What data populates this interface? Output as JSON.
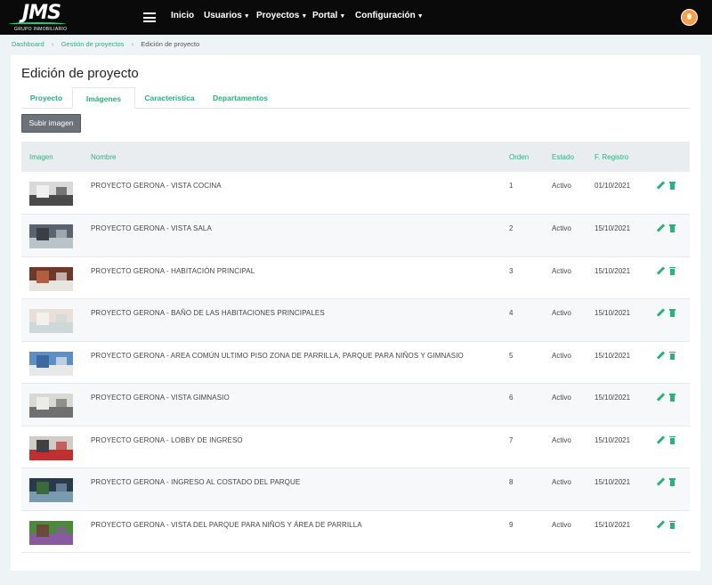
{
  "logo": {
    "text": "JMS",
    "sub": "GRUPO INMOBILIARIO"
  },
  "nav": {
    "menu_icon": "hamburger-icon",
    "items": [
      {
        "label": "Inicio",
        "dropdown": false
      },
      {
        "label": "Usuarios",
        "dropdown": true
      },
      {
        "label": "Proyectos",
        "dropdown": true
      },
      {
        "label": "Portal",
        "dropdown": true
      },
      {
        "label": "Configuración",
        "dropdown": true
      }
    ],
    "avatar_icon": "user-avatar-icon"
  },
  "breadcrumb": {
    "items": [
      "Dashboard",
      "Gestión de proyectos"
    ],
    "current": "Edición de proyecto"
  },
  "page": {
    "title": "Edición de proyecto",
    "tabs": [
      {
        "label": "Proyecto",
        "active": false
      },
      {
        "label": "Imágenes",
        "active": true
      },
      {
        "label": "Caracteristica",
        "active": false
      },
      {
        "label": "Departamentos",
        "active": false
      }
    ],
    "upload_button": "Subir imagen"
  },
  "table": {
    "headers": {
      "image": "Imagen",
      "name": "Nombre",
      "order": "Orden",
      "state": "Estado",
      "date": "F. Registro"
    },
    "rows": [
      {
        "name": "PROYECTO GERONA - VISTA COCINA",
        "order": "1",
        "state": "Activo",
        "date": "01/10/2021",
        "thumb_colors": [
          "#d9d9d9",
          "#4a4a4a",
          "#f0f0f0"
        ]
      },
      {
        "name": "PROYECTO GERONA - VISTA SALA",
        "order": "2",
        "state": "Activo",
        "date": "15/10/2021",
        "thumb_colors": [
          "#5a6470",
          "#b8c4c8",
          "#3a3f45"
        ]
      },
      {
        "name": "PROYECTO GERONA - HABITACIÓN PRINCIPAL",
        "order": "3",
        "state": "Activo",
        "date": "15/10/2021",
        "thumb_colors": [
          "#6b3a2a",
          "#e8e4e0",
          "#b06040"
        ]
      },
      {
        "name": "PROYECTO GERONA - BAÑO DE LAS HABITACIONES PRINCIPALES",
        "order": "4",
        "state": "Activo",
        "date": "15/10/2021",
        "thumb_colors": [
          "#e8e0d8",
          "#cfd8d8",
          "#f4f0ec"
        ]
      },
      {
        "name": "PROYECTO GERONA - AREA COMÚN ULTIMO PISO ZONA DE PARRILLA, PARQUE PARA NIÑOS Y GIMNASIO",
        "order": "5",
        "state": "Activo",
        "date": "15/10/2021",
        "thumb_colors": [
          "#5a8fc8",
          "#e8e8e8",
          "#3a6aa0"
        ]
      },
      {
        "name": "PROYECTO GERONA - VISTA GIMNASIO",
        "order": "6",
        "state": "Activo",
        "date": "15/10/2021",
        "thumb_colors": [
          "#d8d8d4",
          "#707070",
          "#ecece8"
        ]
      },
      {
        "name": "PROYECTO GERONA - LOBBY DE INGRESO",
        "order": "7",
        "state": "Activo",
        "date": "15/10/2021",
        "thumb_colors": [
          "#d0ccc8",
          "#c03030",
          "#404040"
        ]
      },
      {
        "name": "PROYECTO GERONA - INGRESO AL COSTADO DEL PARQUE",
        "order": "8",
        "state": "Activo",
        "date": "15/10/2021",
        "thumb_colors": [
          "#2a3a4a",
          "#7a9ab0",
          "#3a6a3a"
        ]
      },
      {
        "name": "PROYECTO GERONA - VISTA DEL PARQUE PARA NIÑOS Y ÁREA DE PARRILLA",
        "order": "9",
        "state": "Activo",
        "date": "15/10/2021",
        "thumb_colors": [
          "#4a8a3a",
          "#8a5aa0",
          "#6a4a3a"
        ]
      }
    ],
    "row_actions": [
      "pencil-icon",
      "trash-icon"
    ]
  },
  "colors": {
    "accent": "#2ab27b",
    "navbar": "#0a0a0a",
    "button": "#6c7279"
  }
}
